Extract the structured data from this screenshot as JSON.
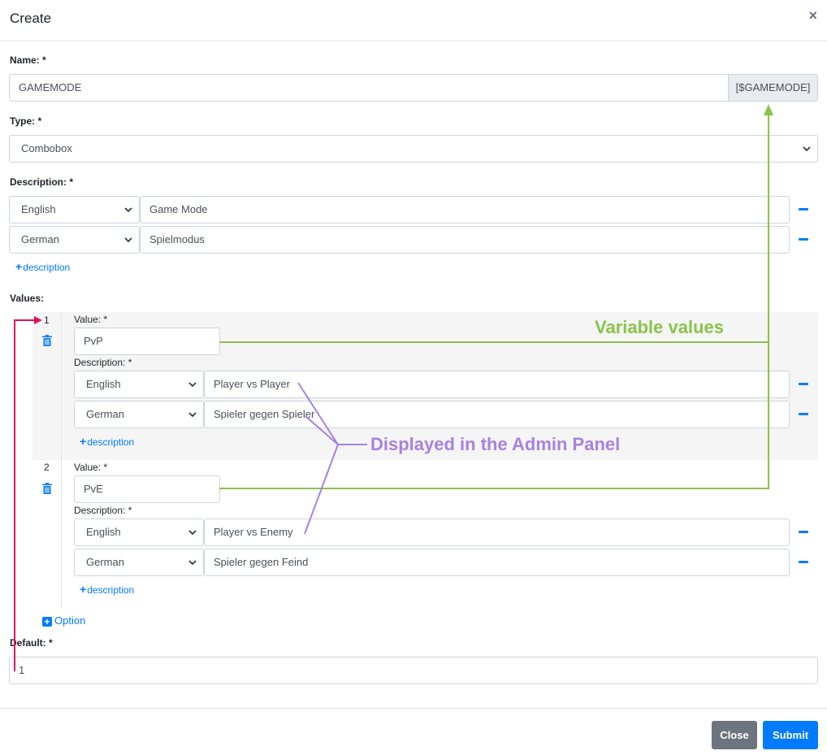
{
  "modal": {
    "title": "Create",
    "close_glyph": "×"
  },
  "name": {
    "label": "Name: *",
    "value": "GAMEMODE",
    "addon": "[$GAMEMODE]"
  },
  "type": {
    "label": "Type: *",
    "value": "Combobox"
  },
  "description": {
    "label": "Description: *",
    "rows": [
      {
        "language": "English",
        "text": "Game Mode"
      },
      {
        "language": "German",
        "text": "Spielmodus"
      }
    ],
    "add_label": "description"
  },
  "values": {
    "label": "Values:",
    "options": [
      {
        "number": "1",
        "value_label": "Value: *",
        "value": "PvP",
        "desc_label": "Description: *",
        "rows": [
          {
            "language": "English",
            "text": "Player vs Player"
          },
          {
            "language": "German",
            "text": "Spieler gegen Spieler"
          }
        ],
        "add_label": "description"
      },
      {
        "number": "2",
        "value_label": "Value: *",
        "value": "PvE",
        "desc_label": "Description: *",
        "rows": [
          {
            "language": "English",
            "text": "Player vs Enemy"
          },
          {
            "language": "German",
            "text": "Spieler gegen Feind"
          }
        ],
        "add_label": "description"
      }
    ],
    "add_option_label": "Option"
  },
  "default": {
    "label": "Default: *",
    "value": "1"
  },
  "footer": {
    "close_label": "Close",
    "submit_label": "Submit"
  },
  "annotations": {
    "variable_values": "Variable values",
    "displayed_in_admin": "Displayed in the Admin Panel"
  },
  "colors": {
    "primary": "#007bff",
    "secondary": "#6c757d",
    "annotation_green": "#8bc34a",
    "annotation_purple": "#a782e0",
    "annotation_red": "#e0115f"
  },
  "icons": {
    "close": "close-icon",
    "chevron": "chevron-down-icon",
    "minus": "minus-icon",
    "plus": "plus-icon",
    "trash": "trash-icon",
    "plus_square": "plus-square-icon"
  }
}
